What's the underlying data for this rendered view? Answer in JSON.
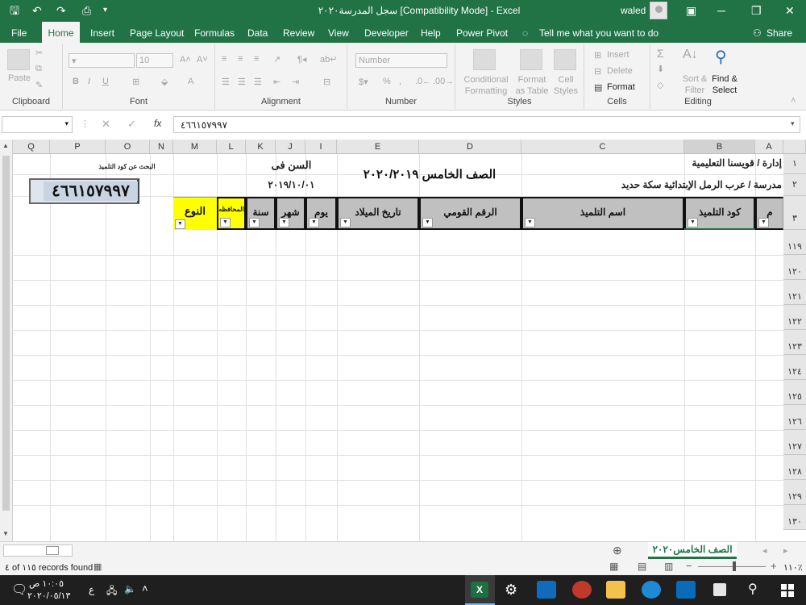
{
  "window": {
    "title": "سجل المدرسة٢٠٢٠ [Compatibility Mode] - Excel",
    "user": "waled"
  },
  "menu": [
    "File",
    "Home",
    "Insert",
    "Page Layout",
    "Formulas",
    "Data",
    "Review",
    "View",
    "Developer",
    "Help",
    "Power Pivot"
  ],
  "tell_me": "Tell me what you want to do",
  "share": "Share",
  "ribbon": {
    "clipboard": {
      "label": "Clipboard",
      "paste": "Paste"
    },
    "font": {
      "label": "Font",
      "size": "10",
      "bold": "B",
      "italic": "I",
      "underline": "U"
    },
    "alignment": {
      "label": "Alignment"
    },
    "number": {
      "label": "Number",
      "format": "Number"
    },
    "styles": {
      "label": "Styles",
      "conditional": "Conditional Formatting",
      "format_table": "Format as Table",
      "cell_styles": "Cell Styles"
    },
    "cells": {
      "label": "Cells",
      "insert": "Insert",
      "delete": "Delete",
      "format": "Format"
    },
    "editing": {
      "label": "Editing",
      "sort": "Sort & Filter",
      "find": "Find & Select"
    }
  },
  "formula_bar": {
    "fx": "fx",
    "value": "٤٦٦١٥٧٩٩٧"
  },
  "columns": [
    "A",
    "B",
    "C",
    "D",
    "E",
    "I",
    "J",
    "K",
    "L",
    "M",
    "N",
    "O",
    "P",
    "Q"
  ],
  "sheet": {
    "b1": "إدارة / قويسنا التعليمية",
    "b2": "مدرسة / عرب الرمل الإبتدائية سكة حديد",
    "e_title": "الصف الخامس ٢٠٢٠/٢٠١٩",
    "age_label": "السن فى",
    "age_date": "٢٠١٩/١٠/٠١",
    "search_label": "البحث عن كود التلميذ",
    "search_value": "٤٦٦١٥٧٩٩٧",
    "headers": {
      "m": "م",
      "code": "كود التلميذ",
      "name": "اسم التلميذ",
      "national": "الرقم القومي",
      "birth": "تاريخ الميلاد",
      "day": "يوم",
      "month": "شهر",
      "year": "سنة",
      "gov": "المحافظه",
      "gender": "النوع"
    }
  },
  "row_numbers": [
    "١",
    "٢",
    "٣",
    "١١٩",
    "١٢٠",
    "١٢١",
    "١٢٢",
    "١٢٣",
    "١٢٤",
    "١٢٥",
    "١٢٦",
    "١٢٧",
    "١٢٨",
    "١٢٩",
    "١٣٠"
  ],
  "sheet_tab": "الصف الخامس٢٠٢٠",
  "status": {
    "records": "٤ of ١١٥ records found",
    "zoom": "١١٠٪"
  },
  "taskbar": {
    "time": "١٠:٠٥ ص",
    "date": "٢٠٢٠/٠٥/١٣",
    "lang": "ع"
  }
}
